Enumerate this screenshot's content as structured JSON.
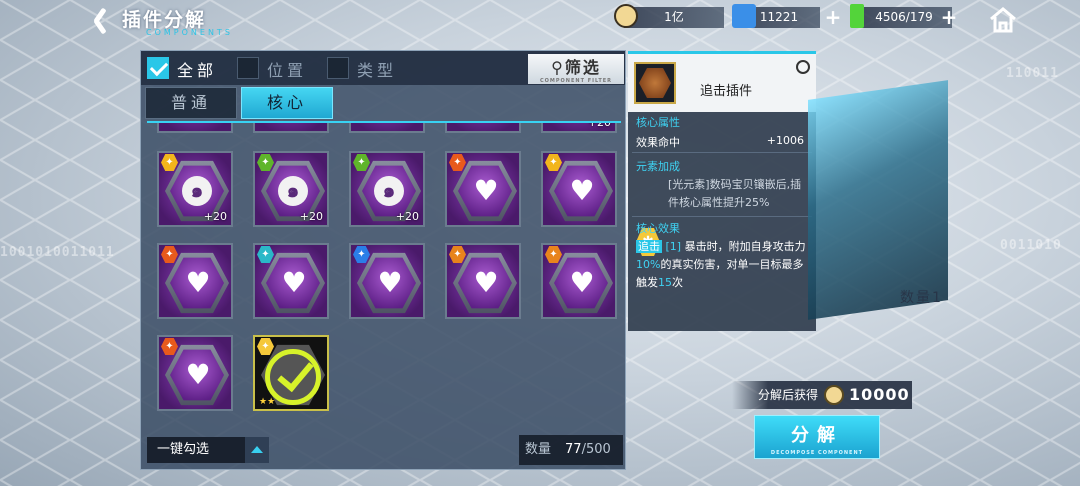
{
  "header": {
    "title": "插件分解",
    "subtitle": "COMPONENTS",
    "resources": [
      {
        "icon": "coin-icon",
        "value": "1亿"
      },
      {
        "icon": "card-icon",
        "value": "11221"
      },
      {
        "icon": "battery-icon",
        "value": "4506/179"
      }
    ]
  },
  "filters": {
    "all_label": "全部",
    "position_label": "位置",
    "type_label": "类型",
    "filter_button": "筛选",
    "filter_button_small": "COMPONENT FILTER"
  },
  "tabs": [
    "普通",
    "核心"
  ],
  "grid": {
    "top_partial_levels": [
      "",
      "",
      "",
      "",
      "+20"
    ],
    "cards": [
      {
        "element": "gold",
        "emblem": "swirl",
        "level": "+20"
      },
      {
        "element": "green",
        "emblem": "swirl",
        "level": "+20"
      },
      {
        "element": "green",
        "emblem": "swirl",
        "level": "+20"
      },
      {
        "element": "fire",
        "emblem": "heart",
        "level": ""
      },
      {
        "element": "gold",
        "emblem": "heart",
        "level": ""
      },
      {
        "element": "fire",
        "emblem": "heart",
        "level": ""
      },
      {
        "element": "cyan",
        "emblem": "heart",
        "level": ""
      },
      {
        "element": "water",
        "emblem": "heart",
        "level": ""
      },
      {
        "element": "orange",
        "emblem": "heart",
        "level": ""
      },
      {
        "element": "orange",
        "emblem": "heart",
        "level": ""
      },
      {
        "element": "fire",
        "emblem": "heart",
        "level": ""
      },
      {
        "element": "light",
        "emblem": "selected",
        "level": "",
        "stars": "★★"
      }
    ]
  },
  "bottom": {
    "one_key_label": "一键勾选",
    "count_label": "数量",
    "count_current": "77",
    "count_total": "/500"
  },
  "detail": {
    "name": "追击插件",
    "core_attr_title": "核心属性",
    "attr_name": "效果命中",
    "attr_value": "+1006",
    "element_bonus_title": "元素加成",
    "element_bonus_text": "[光元素]数码宝贝镶嵌后,插件核心属性提升25%",
    "core_effect_title": "核心效果",
    "effect_tag": "追击",
    "effect_level": "[1]",
    "effect_text_1": "暴击时，附加自身攻击力",
    "effect_pct": "10%",
    "effect_text_2": "的真实伤害，对单一目标最多触发",
    "effect_times": "15",
    "effect_text_3": "次"
  },
  "cube_qty": "数量1",
  "reward": {
    "label": "分解后获得",
    "value": "10000"
  },
  "decompose": {
    "label": "分解",
    "small": "DECOMPOSE COMPONENT"
  },
  "colors": {
    "accent": "#2ac7e8",
    "purple": "#6a2591"
  }
}
